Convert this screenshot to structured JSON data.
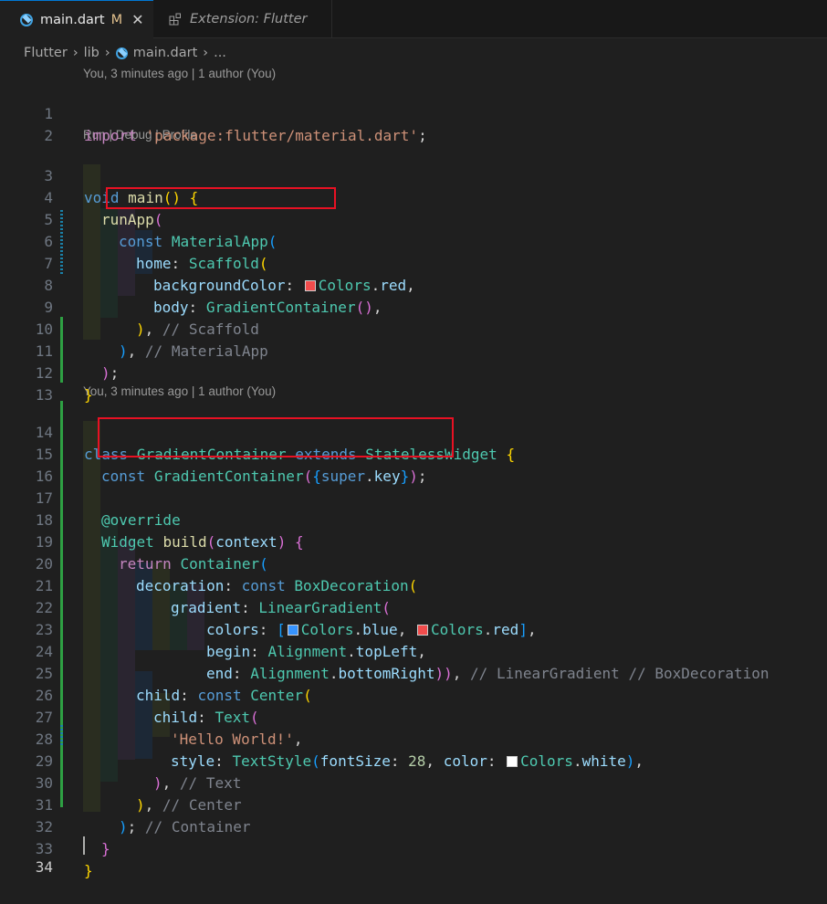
{
  "tabs": [
    {
      "label": "main.dart",
      "status": "M",
      "close": "✕"
    },
    {
      "label": "Extension: Flutter"
    }
  ],
  "breadcrumb": [
    "Flutter",
    "lib",
    "main.dart",
    "..."
  ],
  "codelens": {
    "blame1": "You, 3 minutes ago | 1 author (You)",
    "run": "Run | Debug | Profile",
    "blame2": "You, 3 minutes ago | 1 author (You)"
  },
  "line_numbers": [
    "1",
    "2",
    "3",
    "4",
    "5",
    "6",
    "7",
    "8",
    "9",
    "10",
    "11",
    "12",
    "13",
    "14",
    "15",
    "16",
    "17",
    "18",
    "19",
    "20",
    "21",
    "22",
    "23",
    "24",
    "25",
    "26",
    "27",
    "28",
    "29",
    "30",
    "31",
    "32",
    "33",
    "34"
  ],
  "code": {
    "l1": {
      "kw": "import",
      "str": "'package:flutter/material.dart'",
      "end": ";"
    },
    "l3": {
      "kw": "void",
      "fn": "main",
      "p": "()",
      "b": "{"
    },
    "l4": {
      "fn": "runApp",
      "b": "("
    },
    "l5": {
      "kw": "const",
      "ty": "MaterialApp",
      "b": "("
    },
    "l6": {
      "prop": "home",
      "colon": ":",
      "ty": "Scaffold",
      "b": "("
    },
    "l7": {
      "prop": "backgroundColor",
      "colon": ":",
      "swatch": "#f14c4c",
      "ty": "Colors",
      "dot": ".",
      "val": "red",
      "comma": ","
    },
    "l8": {
      "prop": "body",
      "colon": ":",
      "ty": "GradientContainer",
      "b": "()",
      "comma": ","
    },
    "l9": {
      "b": ")",
      "comma": ",",
      "cm": "// Scaffold"
    },
    "l10": {
      "b": ")",
      "comma": ",",
      "cm": "// MaterialApp"
    },
    "l11": {
      "b": ")",
      "end": ";"
    },
    "l12": {
      "b": "}"
    },
    "l14": {
      "kw": "class",
      "ty": "GradientContainer",
      "kw2": "extends",
      "ty2": "StatelessWidget",
      "b": "{"
    },
    "l15": {
      "kw": "const",
      "ty": "GradientContainer",
      "b1": "(",
      "b2": "{",
      "sup": "super",
      "dot": ".",
      "key": "key",
      "b3": "}",
      "b4": ")",
      "end": ";"
    },
    "l17": {
      "anno": "@override"
    },
    "l18": {
      "ty": "Widget",
      "fn": "build",
      "b1": "(",
      "param": "context",
      "b2": ")",
      "b3": "{"
    },
    "l19": {
      "kw": "return",
      "ty": "Container",
      "b": "("
    },
    "l20": {
      "prop": "decoration",
      "colon": ":",
      "kw": "const",
      "ty": "BoxDecoration",
      "b": "("
    },
    "l21": {
      "prop": "gradient",
      "colon": ":",
      "ty": "LinearGradient",
      "b": "("
    },
    "l22": {
      "prop": "colors",
      "colon": ":",
      "b1": "[",
      "sw1": "#3794ff",
      "ty1": "Colors",
      "dot1": ".",
      "v1": "blue",
      "comma": ",",
      "sw2": "#f14c4c",
      "ty2": "Colors",
      "dot2": ".",
      "v2": "red",
      "b2": "]",
      "end": ","
    },
    "l23": {
      "prop": "begin",
      "colon": ":",
      "ty": "Alignment",
      "dot": ".",
      "val": "topLeft",
      "comma": ","
    },
    "l24": {
      "prop": "end",
      "colon": ":",
      "ty": "Alignment",
      "dot": ".",
      "val": "bottomRight",
      "b": "))",
      "comma": ",",
      "cm": "// LinearGradient // BoxDecoration"
    },
    "l25": {
      "prop": "child",
      "colon": ":",
      "kw": "const",
      "ty": "Center",
      "b": "("
    },
    "l26": {
      "prop": "child",
      "colon": ":",
      "ty": "Text",
      "b": "("
    },
    "l27": {
      "str": "'Hello World!'",
      "comma": ","
    },
    "l28": {
      "prop": "style",
      "colon": ":",
      "ty": "TextStyle",
      "b1": "(",
      "prop2": "fontSize",
      "colon2": ":",
      "num": "28",
      "comma2": ",",
      "prop3": "color",
      "colon3": ":",
      "swatch": "#ffffff",
      "ty2": "Colors",
      "dot": ".",
      "val": "white",
      "b2": ")",
      "comma": ","
    },
    "l29": {
      "b": ")",
      "comma": ",",
      "cm": "// Text"
    },
    "l30": {
      "b": ")",
      "comma": ",",
      "cm": "// Center"
    },
    "l31": {
      "b": ")",
      "end": ";",
      "cm": "// Container"
    },
    "l32": {
      "b": "}"
    },
    "l33": {
      "b": "}"
    }
  }
}
